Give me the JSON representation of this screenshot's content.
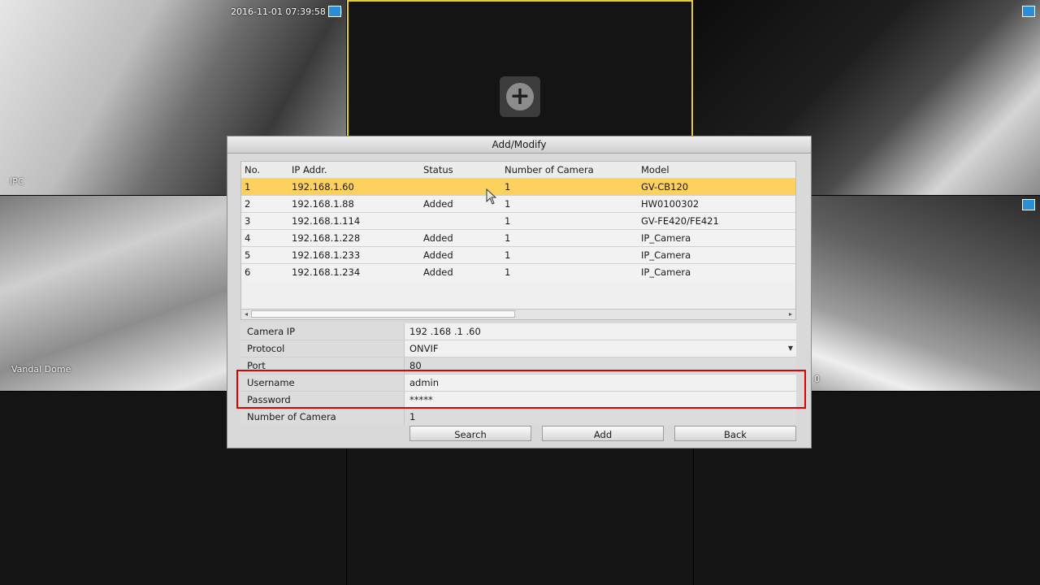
{
  "video_wall": {
    "timestamp": "2016-11-01 07:39:58 AM",
    "pane_labels": [
      "IPC",
      "Vandal Dome",
      "0"
    ]
  },
  "dialog": {
    "title": "Add/Modify",
    "table": {
      "headers": [
        "No.",
        "IP Addr.",
        "Status",
        "Number of Camera",
        "Model"
      ],
      "rows": [
        [
          "1",
          "192.168.1.60",
          "",
          "1",
          "GV-CB120"
        ],
        [
          "2",
          "192.168.1.88",
          "Added",
          "1",
          "HW0100302"
        ],
        [
          "3",
          "192.168.1.114",
          "",
          "1",
          "GV-FE420/FE421"
        ],
        [
          "4",
          "192.168.1.228",
          "Added",
          "1",
          "IP_Camera"
        ],
        [
          "5",
          "192.168.1.233",
          "Added",
          "1",
          "IP_Camera"
        ],
        [
          "6",
          "192.168.1.234",
          "Added",
          "1",
          "IP_Camera"
        ]
      ],
      "selected_row": 0
    },
    "form": {
      "camera_ip_label": "Camera IP",
      "camera_ip_value": "192 .168 .1   .60",
      "protocol_label": "Protocol",
      "protocol_value": "ONVIF",
      "port_label": "Port",
      "port_value": "80",
      "username_label": "Username",
      "username_value": "admin",
      "password_label": "Password",
      "password_value": "*****",
      "num_camera_label": "Number of Camera",
      "num_camera_value": "1"
    },
    "buttons": {
      "search": "Search",
      "add": "Add",
      "back": "Back"
    }
  },
  "colors": {
    "selected_row": "#fcd15e",
    "active_tile_border": "#e6d21a",
    "highlight_box": "#e00000"
  }
}
